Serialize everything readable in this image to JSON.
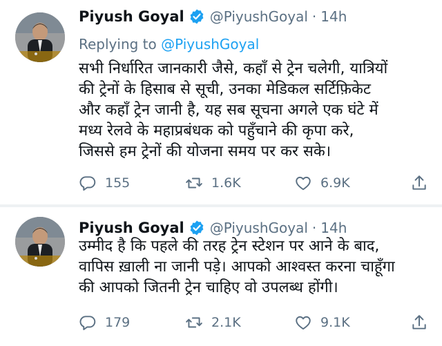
{
  "tweets": [
    {
      "author_name": "Piyush Goyal",
      "handle": "@PiyushGoyal",
      "separator": "·",
      "time": "14h",
      "replying_prefix": "Replying to",
      "replying_mention": "@PiyushGoyal",
      "text": "सभी निर्धारित जानकारी जैसे, कहाँ से ट्रेन चलेगी, यात्रियों\nकी ट्रेनों के हिसाब से सूची, उनका मेडिकल सर्टिफ़िकेट\nऔर कहाँ ट्रेन जानी है, यह सब सूचना अगले एक घंटे में\nमध्य रेलवे के महाप्रबंधक को पहुँचाने की कृपा करे,\nजिससे हम ट्रेनों की योजना समय पर कर सके।",
      "replies": "155",
      "retweets": "1.6K",
      "likes": "6.9K"
    },
    {
      "author_name": "Piyush Goyal",
      "handle": "@PiyushGoyal",
      "separator": "·",
      "time": "14h",
      "text": "उम्मीद है कि पहले की तरह ट्रेन स्टेशन पर आने के बाद,\nवापिस ख़ाली ना जानी पड़े। आपको आश्वस्त करना चाहूँगा\nकी आपको जितनी ट्रेन चाहिए वो उपलब्ध होंगी।",
      "replies": "179",
      "retweets": "2.1K",
      "likes": "9.1K"
    }
  ],
  "colors": {
    "text": "#0f1419",
    "secondary": "#5b7083",
    "accent": "#1da1f2",
    "divider": "#eef1f3"
  },
  "icons": [
    "avatar-photo",
    "verified-icon",
    "reply-icon",
    "retweet-icon",
    "like-icon",
    "share-icon"
  ]
}
